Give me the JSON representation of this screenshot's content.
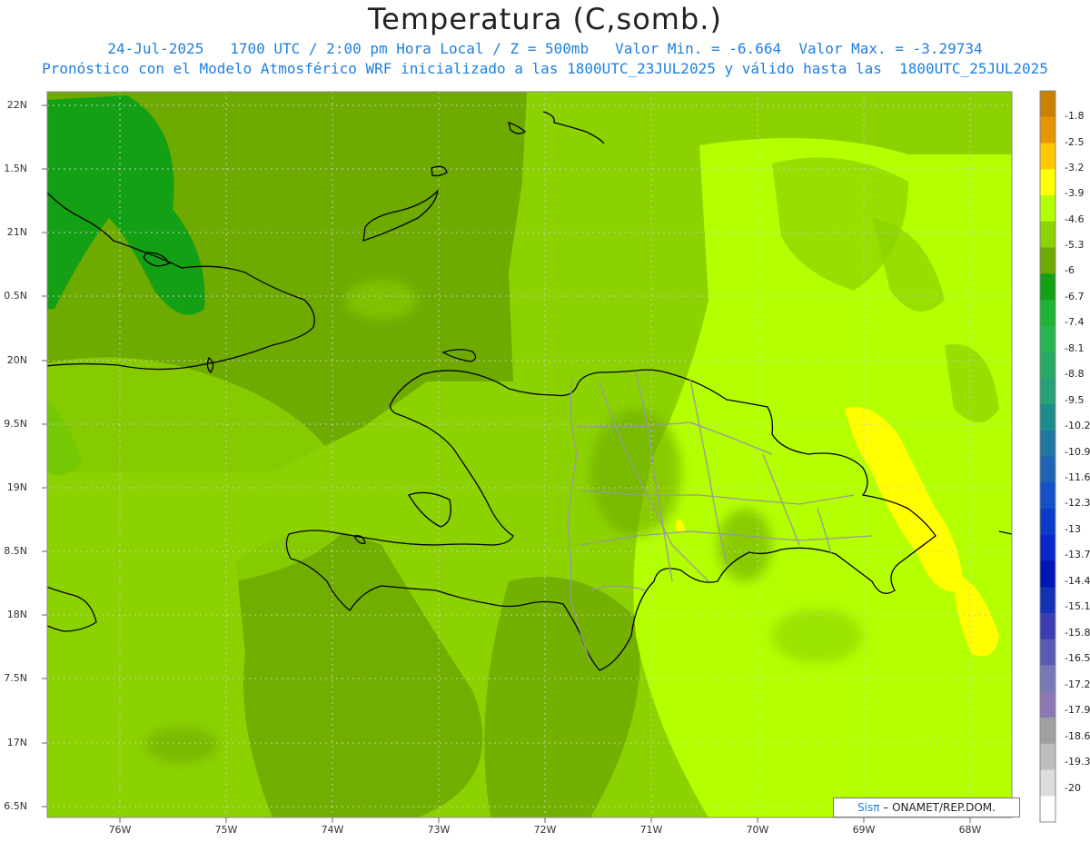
{
  "title": "Temperatura (C,somb.)",
  "subtitle_line1": "24-Jul-2025   1700 UTC / 2:00 pm Hora Local / Z = 500mb   Valor Min. = -6.664  Valor Max. = -3.29734",
  "subtitle_line2": "Pronóstico con el Modelo Atmosférico WRF inicializado a las 1800UTC_23JUL2025 y válido hasta las  1800UTC_25JUL2025",
  "axes": {
    "lat_labels": [
      "22N",
      "1.5N",
      "21N",
      "0.5N",
      "20N",
      "9.5N",
      "19N",
      "8.5N",
      "18N",
      "7.5N",
      "17N",
      "6.5N"
    ],
    "lon_labels": [
      "76W",
      "75W",
      "74W",
      "73W",
      "72W",
      "71W",
      "70W",
      "69W",
      "68W"
    ]
  },
  "colorbar": {
    "labels": [
      "-1.8",
      "-2.5",
      "-3.2",
      "-3.9",
      "-4.6",
      "-5.3",
      "-6",
      "-6.7",
      "-7.4",
      "-8.1",
      "-8.8",
      "-9.5",
      "-10.2",
      "-10.9",
      "-11.6",
      "-12.3",
      "-13",
      "-13.7",
      "-14.4",
      "-15.1",
      "-15.8",
      "-16.5",
      "-17.2",
      "-17.9",
      "-18.6",
      "-19.3",
      "-20"
    ],
    "colors": [
      "#c88200",
      "#e69600",
      "#ffc800",
      "#ffff00",
      "#b4ff00",
      "#8cd200",
      "#6eaa00",
      "#14a014",
      "#1eb432",
      "#28b450",
      "#28aa64",
      "#28a078",
      "#1e8c8c",
      "#1e78a0",
      "#1e64b4",
      "#1450c8",
      "#0a3cc8",
      "#0a28c8",
      "#0014b4",
      "#1432b4",
      "#3c3cb4",
      "#5a5ab4",
      "#7878b4",
      "#8c78b4",
      "#a0a0a0",
      "#bebebe",
      "#dcdcdc",
      "#ffffff"
    ]
  },
  "credit": {
    "brand": "Sisπ",
    "text": " – ONAMET/REP.DOM."
  }
}
